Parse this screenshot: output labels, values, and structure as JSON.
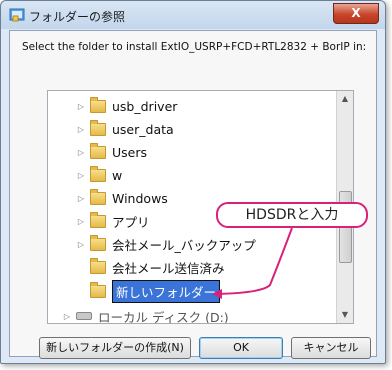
{
  "window": {
    "title": "フォルダーの参照",
    "close_glyph": "X"
  },
  "description": "Select the folder to install ExtIO_USRP+FCD+RTL2832 + BorIP in:",
  "tree": {
    "items": [
      {
        "label": "usb_driver",
        "has_arrow": true
      },
      {
        "label": "user_data",
        "has_arrow": true
      },
      {
        "label": "Users",
        "has_arrow": true
      },
      {
        "label": "w",
        "has_arrow": true
      },
      {
        "label": "Windows",
        "has_arrow": true
      },
      {
        "label": "アプリ",
        "has_arrow": true
      },
      {
        "label": "会社メール_バックアップ",
        "has_arrow": true
      },
      {
        "label": "会社メール送信済み",
        "has_arrow": false
      }
    ],
    "editing_item": "新しいフォルダー",
    "partial_item": "ローカル ディスク (D:)"
  },
  "annotation": {
    "label": "HDSDRと入力",
    "color": "#d9207a"
  },
  "buttons": {
    "new_folder": "新しいフォルダーの作成(N)",
    "ok": "OK",
    "cancel": "キャンセル"
  },
  "colors": {
    "selection": "#3a74d8",
    "callout": "#d9207a"
  }
}
